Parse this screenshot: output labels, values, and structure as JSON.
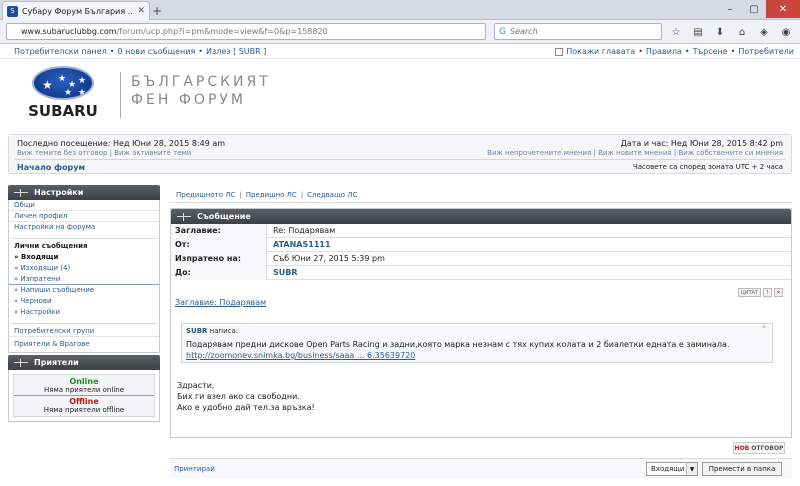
{
  "browser": {
    "tab_title": "Субару Форум България ...",
    "url_host": "www.subaruclubbg.com",
    "url_path": "/forum/ucp.php?i=pm&mode=view&f=0&p=158820",
    "search_placeholder": "Search"
  },
  "topnav": {
    "panel": "Потребителски панел",
    "new_messages": "0 нови съобщения",
    "logout": "Излез [ SUBR ]",
    "show_headers": "Покажи главата",
    "rules": "Правила",
    "search": "Търсене",
    "users": "Потребители"
  },
  "header": {
    "logo_word": "SUBARU",
    "forum_line1": "БЪЛГАРСКИЯТ",
    "forum_line2": "ФЕН ФОРУМ"
  },
  "infobox": {
    "last_visit": "Последно посещение: Нед Юни 28, 2015 8:49 am",
    "links_left": "Виж темите без отговор | Виж активните теми",
    "date_time": "Дата и час: Нед Юни 28, 2015 8:42 pm",
    "links_right": "Виж непрочетените мнения | Виж новите мнения | Виж собствените си мнения",
    "home": "Начало форум",
    "timezone": "Часовете са според зоната UTC + 2 часа"
  },
  "sidebar": {
    "settings_title": "Настройки",
    "items": [
      "Общи",
      "Личен профил",
      "Настройки на форума"
    ],
    "pm_header": "Лични съобщения",
    "pm_items": [
      "» Входящи",
      "» Изходящи (4)",
      "» Изпратени",
      "» Напиши съобщение",
      "» Чернови",
      "» Настройки"
    ],
    "groups": "Потребителски групи",
    "friends_foes": "Приятели & Врагове",
    "friends_title": "Приятели",
    "online": "Online",
    "no_online": "Няма приятели online",
    "offline": "Offline",
    "no_offline": "Няма приятели offline"
  },
  "pmnav": {
    "prev_pm": "Предишното ЛС",
    "prev_pm2": "Предишно ЛС",
    "next_pm": "Следващо ЛС"
  },
  "message": {
    "title": "Съобщение",
    "subject_label": "Заглавие:",
    "subject_value": "Re: Подарявам",
    "from_label": "От:",
    "from_value": "ATANAS1111",
    "sent_label": "Изпратено на:",
    "sent_value": "Съб Юни 27, 2015 5:39 pm",
    "to_label": "До:",
    "to_value": "SUBR",
    "subject_link": "Заглавие: Подарявам",
    "quote_btn": "ЦИТАТ",
    "quote_author": "SUBR",
    "quote_wrote": " написа:",
    "quote_text": "Подарявам предни дискове Open Parts Racing и задни,която марка незнам с тях купих колата и 2 биалетки едната е заминала.",
    "quote_link": "http://zoomonev.snimka.bg/business/saaa ... 6.35639720",
    "body_line1": "Здрасти,",
    "body_line2": "Бих ги взел ако са свободни.",
    "body_line3": "Ако е удобно дай тел.за връзка!"
  },
  "actions": {
    "reply_new": "НОВ",
    "reply_text": "ОТГОВОР",
    "print": "Принтирай",
    "folder_selected": "Входящи",
    "move_button": "Премести в папка"
  }
}
